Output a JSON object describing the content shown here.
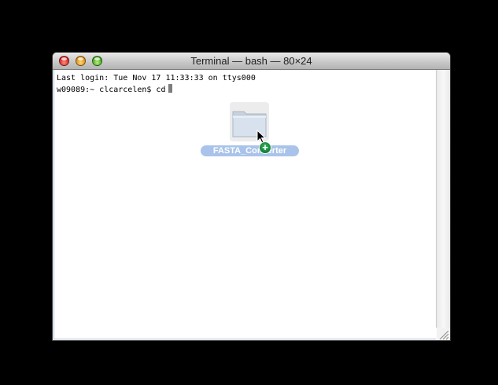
{
  "window": {
    "title": "Terminal — bash — 80×24",
    "buttons": {
      "close": "close-icon",
      "minimize": "minimize-icon",
      "zoom": "zoom-icon"
    }
  },
  "terminal": {
    "lines": [
      "Last login: Tue Nov 17 11:33:33 on ttys000",
      "w09089:~ clcarcelen$ cd"
    ]
  },
  "drag": {
    "item_label": "FASTA_Converter",
    "icon": "folder-icon",
    "badge": "+"
  },
  "colors": {
    "desktop": "#000000",
    "selection": "#a9c3ea",
    "copy_badge": "#0d7a33"
  }
}
